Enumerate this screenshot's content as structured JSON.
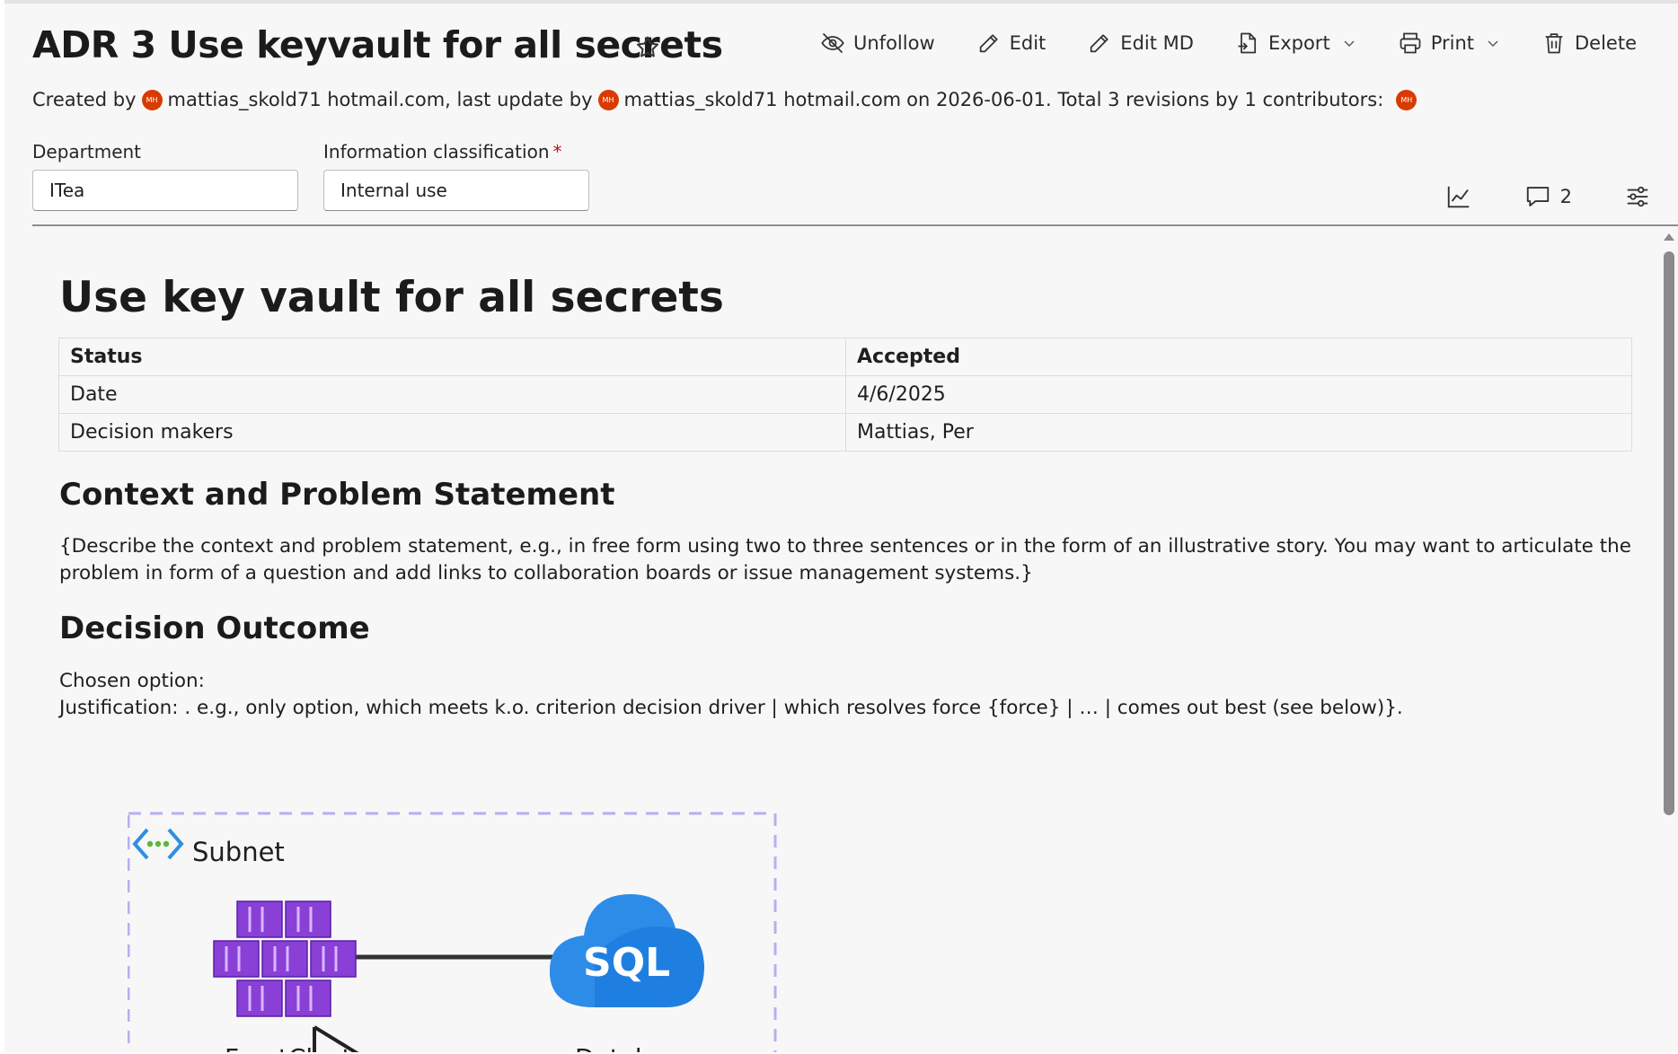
{
  "header": {
    "title": "ADR 3 Use keyvault for all secrets"
  },
  "toolbar": {
    "unfollow": "Unfollow",
    "edit": "Edit",
    "edit_md": "Edit MD",
    "export": "Export",
    "print": "Print",
    "delete": "Delete"
  },
  "meta": {
    "created_by_prefix": "Created by",
    "creator": "mattias_skold71 hotmail.com",
    "last_update_prefix": ", last update by",
    "updater": "mattias_skold71 hotmail.com",
    "on_text": "on 2026-06-01. Total 3 revisions by 1 contributors:",
    "avatar_initials": "MH"
  },
  "fields": {
    "department_label": "Department",
    "department_value": "ITea",
    "classification_label": "Information classification",
    "classification_required": "*",
    "classification_value": "Internal use"
  },
  "side_actions": {
    "comments_count": "2"
  },
  "document": {
    "heading": "Use key vault for all secrets",
    "table": [
      [
        "Status",
        "Accepted"
      ],
      [
        "Date",
        "4/6/2025"
      ],
      [
        "Decision makers",
        "Mattias, Per"
      ]
    ],
    "context_heading": "Context and Problem Statement",
    "context_text": "{Describe the context and problem statement, e.g., in free form using two to three sentences or in the form of an illustrative story. You may want to articulate the problem in form of a question and add links to collaboration boards or issue management systems.}",
    "decision_heading": "Decision Outcome",
    "chosen_option": "Chosen option:",
    "justification": "Justification: . e.g., only option, which meets k.o. criterion decision driver | which resolves force {force} | … | comes out best (see below)}."
  },
  "diagram": {
    "subnet_label": "Subnet",
    "sql_label": "SQL",
    "frontend_label": "FrontCluster",
    "database_label": "Database"
  },
  "colors": {
    "avatar": "#d83b01",
    "required": "#c50f1f",
    "container_purple": "#8a3fd6",
    "sql_blue": "#1f7fe0",
    "subnet_border": "#b9aef0"
  }
}
